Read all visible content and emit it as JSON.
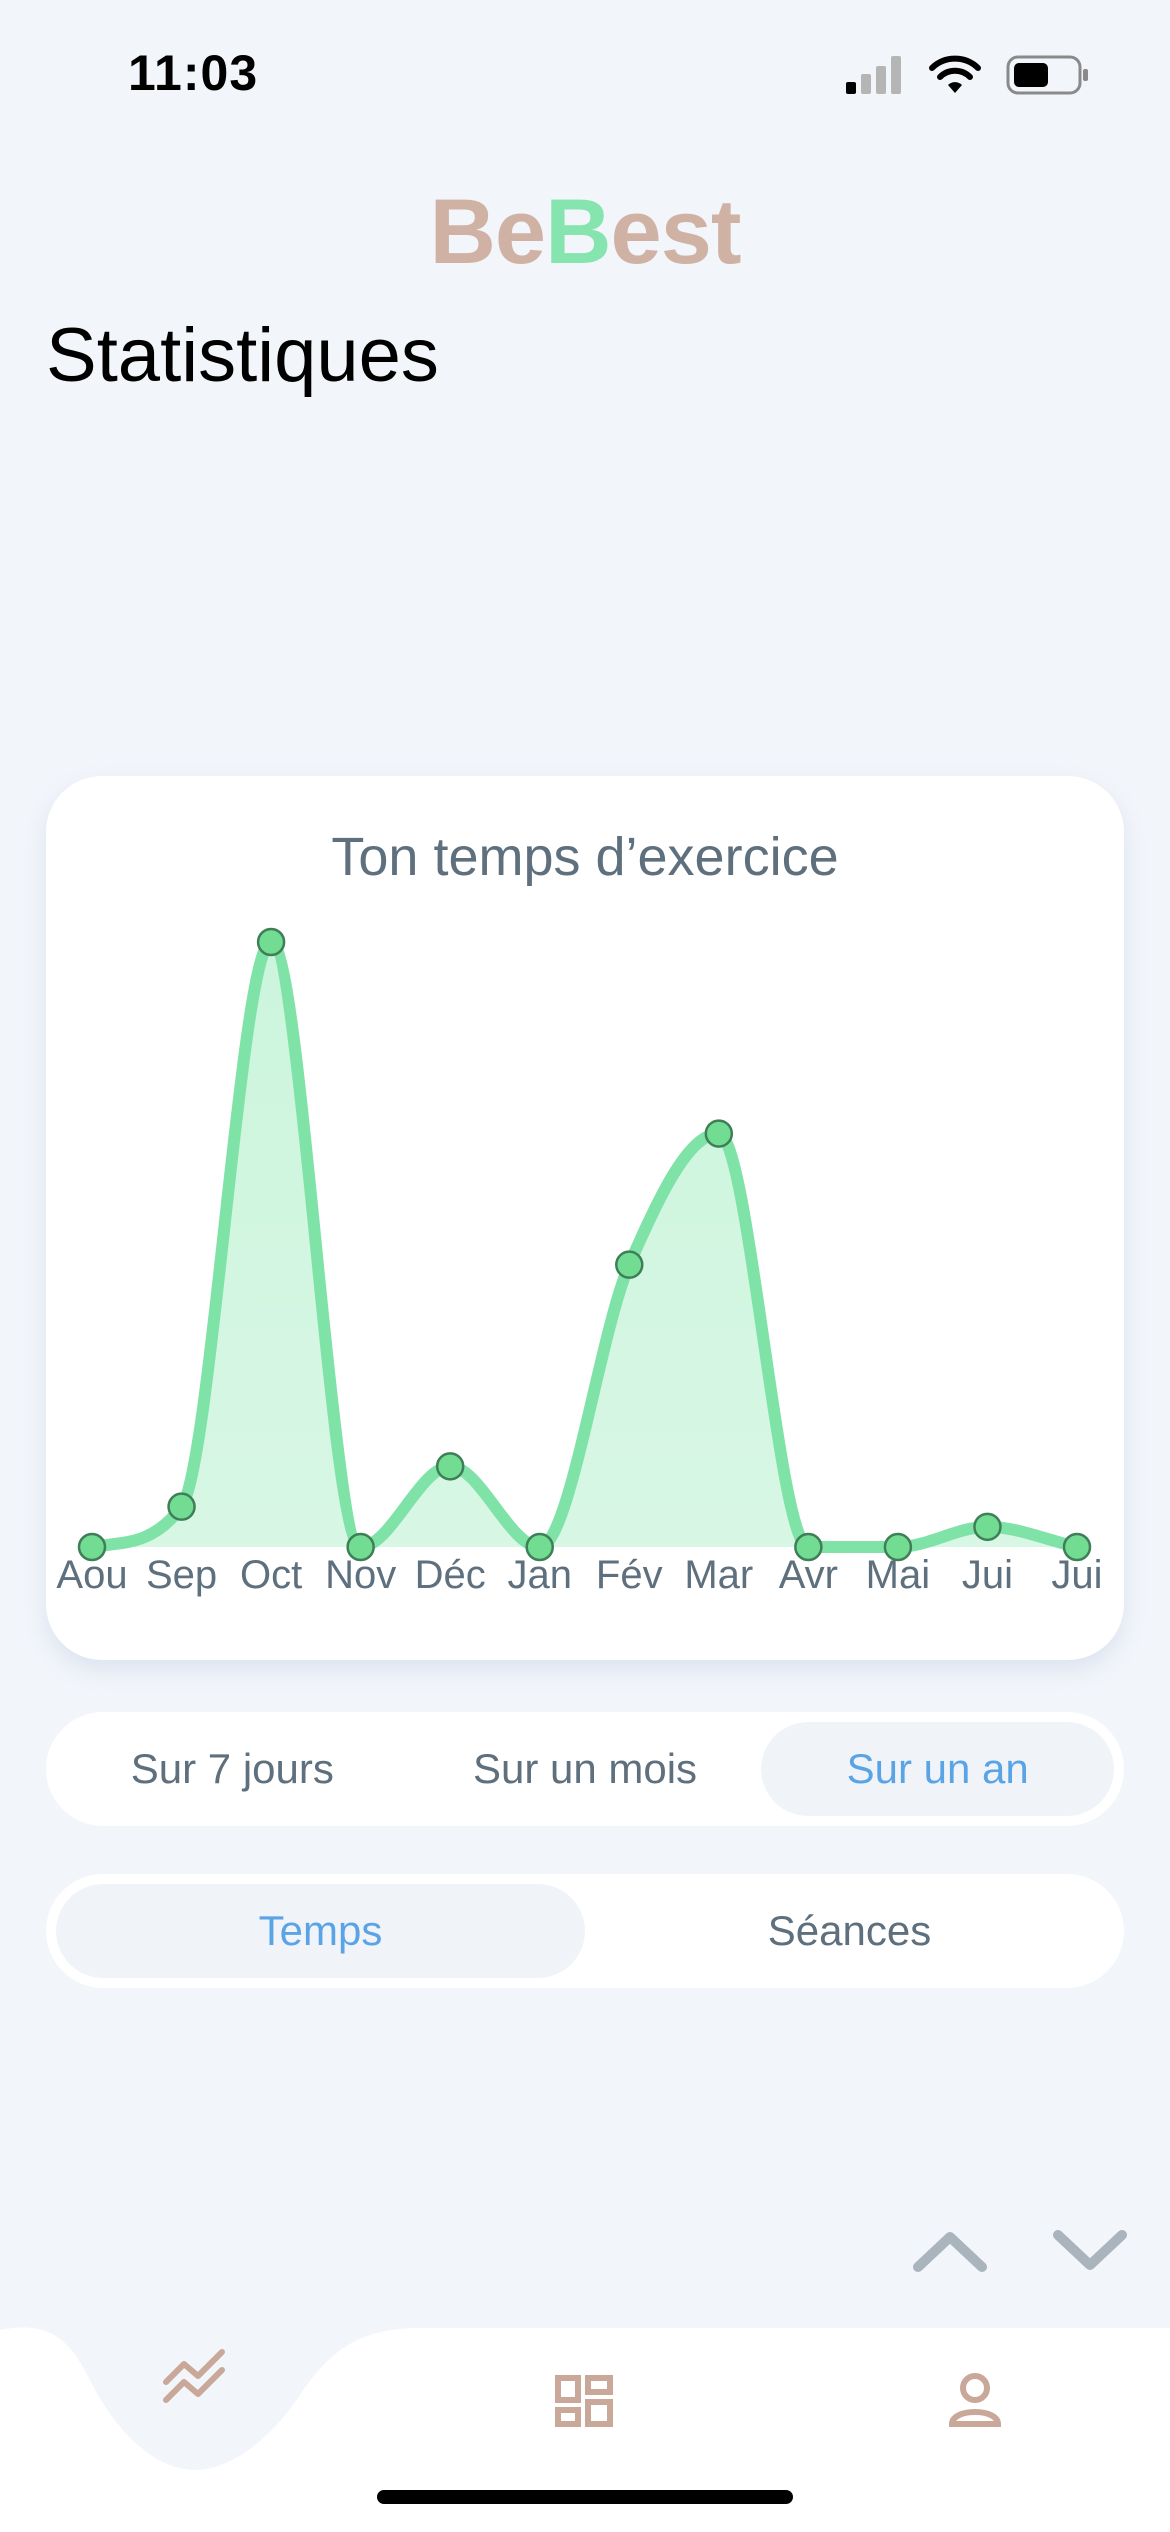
{
  "status_bar": {
    "time": "11:03"
  },
  "app": {
    "logo_part1": "Be",
    "logo_part2": "B",
    "logo_part3": "est"
  },
  "page": {
    "title": "Statistiques"
  },
  "card": {
    "title": "Ton temps d’exercice"
  },
  "period_selector": {
    "options": [
      "Sur 7 jours",
      "Sur un mois",
      "Sur un an"
    ],
    "selected": "Sur un an"
  },
  "metric_selector": {
    "options": [
      "Temps",
      "Séances"
    ],
    "selected": "Temps"
  },
  "colors": {
    "accent_green": "#7fe3a7",
    "accent_blue": "#5aa4e6",
    "brand_tan": "#d0b2a5",
    "nav_icon": "#c9a899",
    "arrow_grey": "#a9b4bc"
  },
  "icons": {
    "nav_left": "trend-chart-icon",
    "nav_center": "grid-icon",
    "nav_right": "user-icon",
    "arrow_up": "chevron-up-icon",
    "arrow_down": "chevron-down-icon"
  },
  "chart_data": {
    "type": "area",
    "categories": [
      "Aou",
      "Sep",
      "Oct",
      "Nov",
      "Déc",
      "Jan",
      "Fév",
      "Mar",
      "Avr",
      "Mai",
      "Jui",
      "Jui"
    ],
    "values": [
      0,
      4,
      60,
      0,
      8,
      0,
      28,
      41,
      0,
      0,
      2,
      0
    ],
    "ylim": [
      0,
      60
    ],
    "grid": false,
    "legend": "none"
  }
}
